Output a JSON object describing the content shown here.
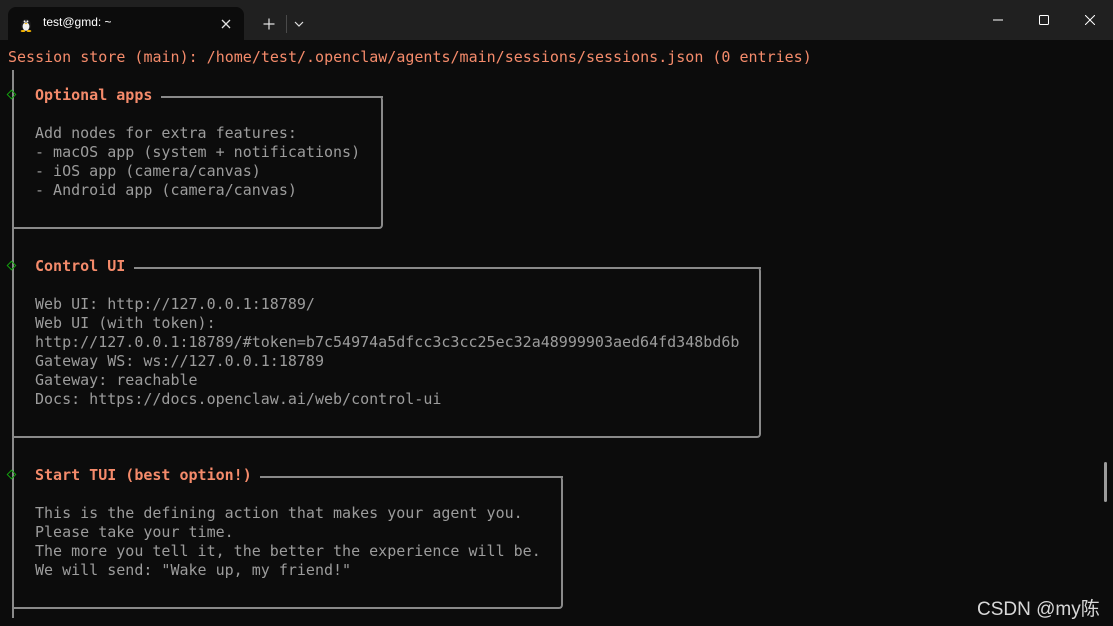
{
  "window": {
    "tab_title": "test@gmd: ~",
    "icons": {
      "tab": "linux-penguin-icon",
      "close_tab": "close-icon",
      "new_tab": "plus-icon",
      "dropdown": "chevron-down-icon",
      "minimize": "minimize-icon",
      "maximize": "maximize-icon",
      "close": "close-icon"
    }
  },
  "terminal": {
    "session_line": "Session store (main): /home/test/.openclaw/agents/main/sessions/sessions.json (0 entries)",
    "sections": [
      {
        "title": "Optional apps",
        "lines": [
          "Add nodes for extra features:",
          "- macOS app (system + notifications)",
          "- iOS app (camera/canvas)",
          "- Android app (camera/canvas)"
        ]
      },
      {
        "title": "Control UI",
        "lines": [
          "Web UI: http://127.0.0.1:18789/",
          "Web UI (with token):",
          "http://127.0.0.1:18789/#token=b7c54974a5dfcc3c3cc25ec32a48999903aed64fd348bd6b",
          "Gateway WS: ws://127.0.0.1:18789",
          "Gateway: reachable",
          "Docs: https://docs.openclaw.ai/web/control-ui"
        ]
      },
      {
        "title": "Start TUI (best option!)",
        "lines": [
          "This is the defining action that makes your agent you.",
          "Please take your time.",
          "The more you tell it, the better the experience will be.",
          "We will send: \"Wake up, my friend!\""
        ]
      }
    ]
  },
  "watermark": "CSDN @my陈",
  "colors": {
    "background": "#0c0c0c",
    "titlebar": "#202020",
    "heading": "#f58b6b",
    "body_text": "#9c9c9c",
    "diamond": "#13a10e",
    "border": "#8a8a8a"
  }
}
